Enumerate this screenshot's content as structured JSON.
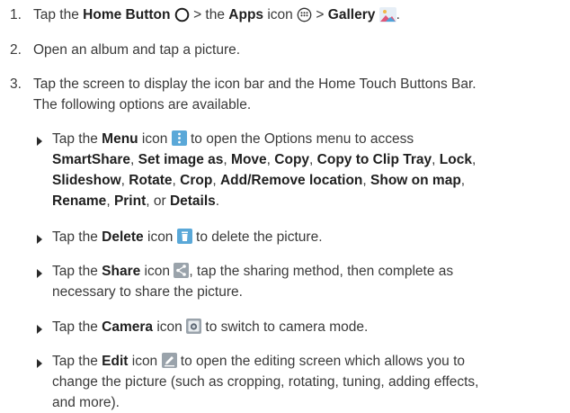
{
  "steps": [
    {
      "num": "1.",
      "t1": "Tap the ",
      "home_label": "Home Button",
      "t2": " > the ",
      "apps_label": "Apps",
      "t3": " icon ",
      "t4": " > ",
      "gallery_label": "Gallery",
      "t5": "."
    },
    {
      "num": "2.",
      "text": "Open an album and tap a picture."
    },
    {
      "num": "3.",
      "line1": "Tap the screen to display the icon bar and the Home Touch Buttons Bar.",
      "line2": "The following options are available."
    }
  ],
  "bullets": {
    "menu": {
      "t1": "Tap the ",
      "label": "Menu",
      "t2": " icon ",
      "t3": " to open the Options menu to access",
      "opts": {
        "smartshare": "SmartShare",
        "set_image_as": "Set image as",
        "move": "Move",
        "copy": "Copy",
        "copy_to_clip_tray": "Copy to Clip Tray",
        "lock": "Lock",
        "slideshow": "Slideshow",
        "rotate": "Rotate",
        "crop": "Crop",
        "add_remove_location": "Add/Remove location",
        "show_on_map": "Show on map",
        "rename": "Rename",
        "print": "Print",
        "details": "Details"
      },
      "sep": ", ",
      "or": ", or ",
      "end": "."
    },
    "delete": {
      "t1": "Tap the ",
      "label": "Delete",
      "t2": " icon ",
      "t3": " to delete the picture."
    },
    "share": {
      "t1": "Tap the ",
      "label": "Share",
      "t2": " icon ",
      "t3": ", tap the sharing method, then complete as",
      "line2": "necessary to share the picture."
    },
    "camera": {
      "t1": "Tap the ",
      "label": "Camera",
      "t2": " icon ",
      "t3": " to switch to camera mode."
    },
    "edit": {
      "t1": "Tap the ",
      "label": "Edit",
      "t2": " icon ",
      "t3": " to open the editing screen which allows you to",
      "line2": "change the picture (such as cropping, rotating, tuning, adding effects,",
      "line3": "and more)."
    }
  },
  "colors": {
    "text": "#3a3a3a",
    "bold": "#1f1f1f",
    "icon_blue": "#5aa8d8",
    "icon_gray": "#9aa3ab"
  },
  "icons": [
    "home-button-icon",
    "apps-icon",
    "gallery-icon",
    "menu-icon",
    "delete-icon",
    "share-icon",
    "camera-icon",
    "edit-icon"
  ]
}
